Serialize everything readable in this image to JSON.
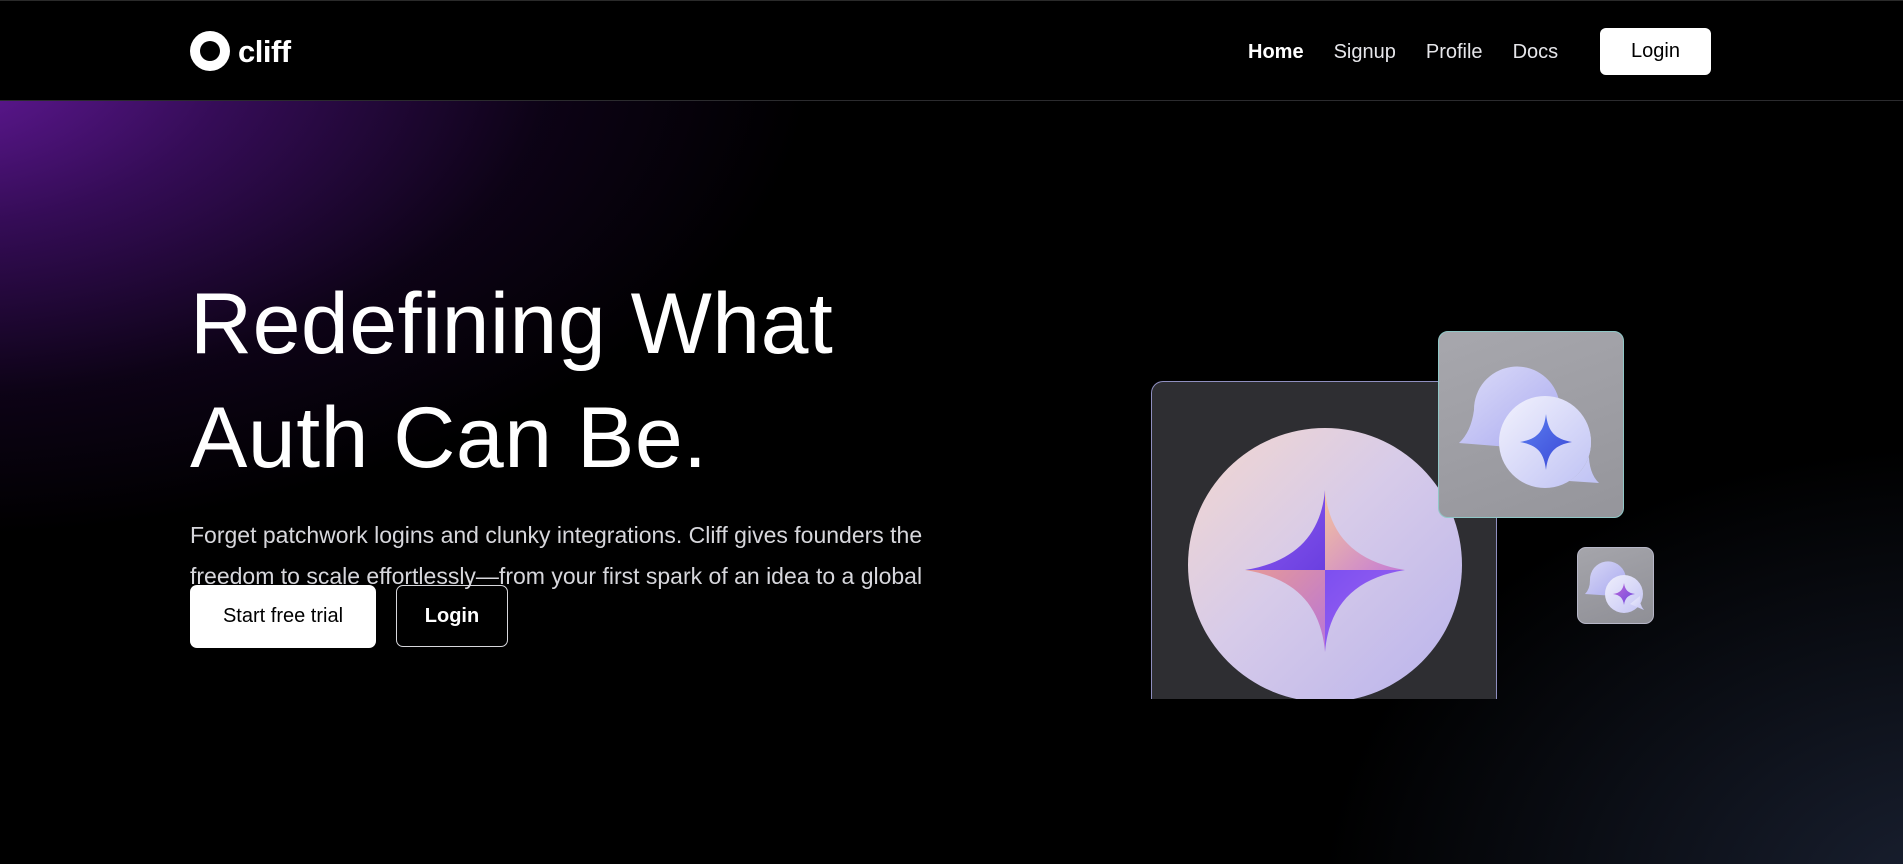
{
  "header": {
    "logo_text": "cliff",
    "nav": [
      {
        "label": "Home",
        "active": true
      },
      {
        "label": "Signup",
        "active": false
      },
      {
        "label": "Profile",
        "active": false
      },
      {
        "label": "Docs",
        "active": false
      }
    ],
    "login_label": "Login"
  },
  "hero": {
    "title_line1": "Redefining What",
    "title_line2": "Auth Can Be.",
    "description": "Forget patchwork logins and clunky integrations. Cliff gives founders the freedom to scale effortlessly—from your first spark of an idea to a global user base.",
    "primary_cta": "Start free trial",
    "secondary_cta": "Login"
  },
  "illustration": {
    "icons": [
      "sparkle-icon",
      "chat-bubbles-icon",
      "chat-bubbles-icon"
    ]
  },
  "colors": {
    "background": "#000000",
    "accent_purple": "#6e1caa",
    "button_bg": "#ffffff"
  }
}
